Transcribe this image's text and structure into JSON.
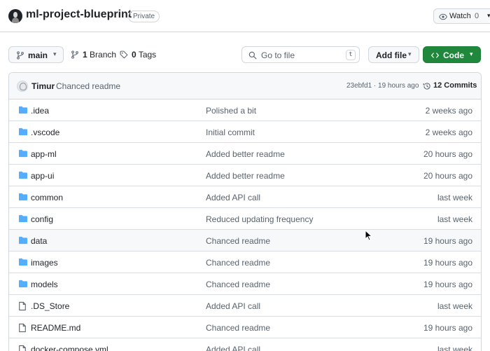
{
  "repo": {
    "name": "ml-project-blueprint",
    "visibility": "Private",
    "watch_label": "Watch",
    "watch_count": "0"
  },
  "toolbar": {
    "branch": "main",
    "branches_count": "1",
    "branches_label": "Branch",
    "tags_count": "0",
    "tags_label": "Tags",
    "goto_placeholder": "Go to file",
    "goto_shortcut": "t",
    "add_file_label": "Add file",
    "code_label": "Code"
  },
  "latest_commit": {
    "author": "Timur",
    "message": "Chanced readme",
    "info": "23ebfd1 · 19 hours ago",
    "commits_label": "12 Commits"
  },
  "files": [
    {
      "type": "folder",
      "name": ".idea",
      "message": "Polished a bit",
      "date": "2 weeks ago"
    },
    {
      "type": "folder",
      "name": ".vscode",
      "message": "Initial commit",
      "date": "2 weeks ago"
    },
    {
      "type": "folder",
      "name": "app-ml",
      "message": "Added better readme",
      "date": "20 hours ago"
    },
    {
      "type": "folder",
      "name": "app-ui",
      "message": "Added better readme",
      "date": "20 hours ago"
    },
    {
      "type": "folder",
      "name": "common",
      "message": "Added API call",
      "date": "last week"
    },
    {
      "type": "folder",
      "name": "config",
      "message": "Reduced updating frequency",
      "date": "last week"
    },
    {
      "type": "folder",
      "name": "data",
      "message": "Chanced readme",
      "date": "19 hours ago"
    },
    {
      "type": "folder",
      "name": "images",
      "message": "Chanced readme",
      "date": "19 hours ago"
    },
    {
      "type": "folder",
      "name": "models",
      "message": "Chanced readme",
      "date": "19 hours ago"
    },
    {
      "type": "file",
      "name": ".DS_Store",
      "message": "Added API call",
      "date": "last week"
    },
    {
      "type": "file",
      "name": "README.md",
      "message": "Chanced readme",
      "date": "19 hours ago"
    },
    {
      "type": "file",
      "name": "docker-compose.yml",
      "message": "Added API call",
      "date": "last week"
    }
  ],
  "colors": {
    "accent_green": "#1f883d",
    "folder_blue": "#54aeff",
    "muted_text": "#59636e",
    "border": "#d0d7de"
  }
}
